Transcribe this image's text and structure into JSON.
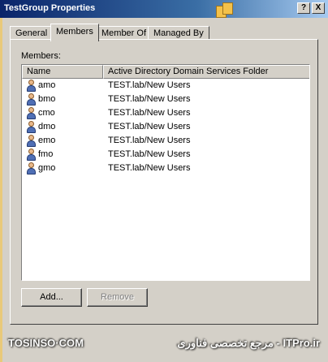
{
  "window": {
    "title": "TestGroup Properties",
    "help_label": "?",
    "close_label": "X"
  },
  "tabs": [
    {
      "label": "General"
    },
    {
      "label": "Members"
    },
    {
      "label": "Member Of"
    },
    {
      "label": "Managed By"
    }
  ],
  "members": {
    "label": "Members:",
    "columns": [
      "Name",
      "Active Directory Domain Services Folder"
    ],
    "rows": [
      {
        "name": "amo",
        "folder": "TEST.lab/New Users"
      },
      {
        "name": "bmo",
        "folder": "TEST.lab/New Users"
      },
      {
        "name": "cmo",
        "folder": "TEST.lab/New Users"
      },
      {
        "name": "dmo",
        "folder": "TEST.lab/New Users"
      },
      {
        "name": "emo",
        "folder": "TEST.lab/New Users"
      },
      {
        "name": "fmo",
        "folder": "TEST.lab/New Users"
      },
      {
        "name": "gmo",
        "folder": "TEST.lab/New Users"
      }
    ],
    "row_icon": "user-icon"
  },
  "buttons": {
    "add": "Add...",
    "remove": "Remove"
  },
  "footer": {
    "watermark_left": "TOSINSO·COM",
    "watermark_right": "مرجع تخصصی فناوری - ITPro.ir"
  }
}
